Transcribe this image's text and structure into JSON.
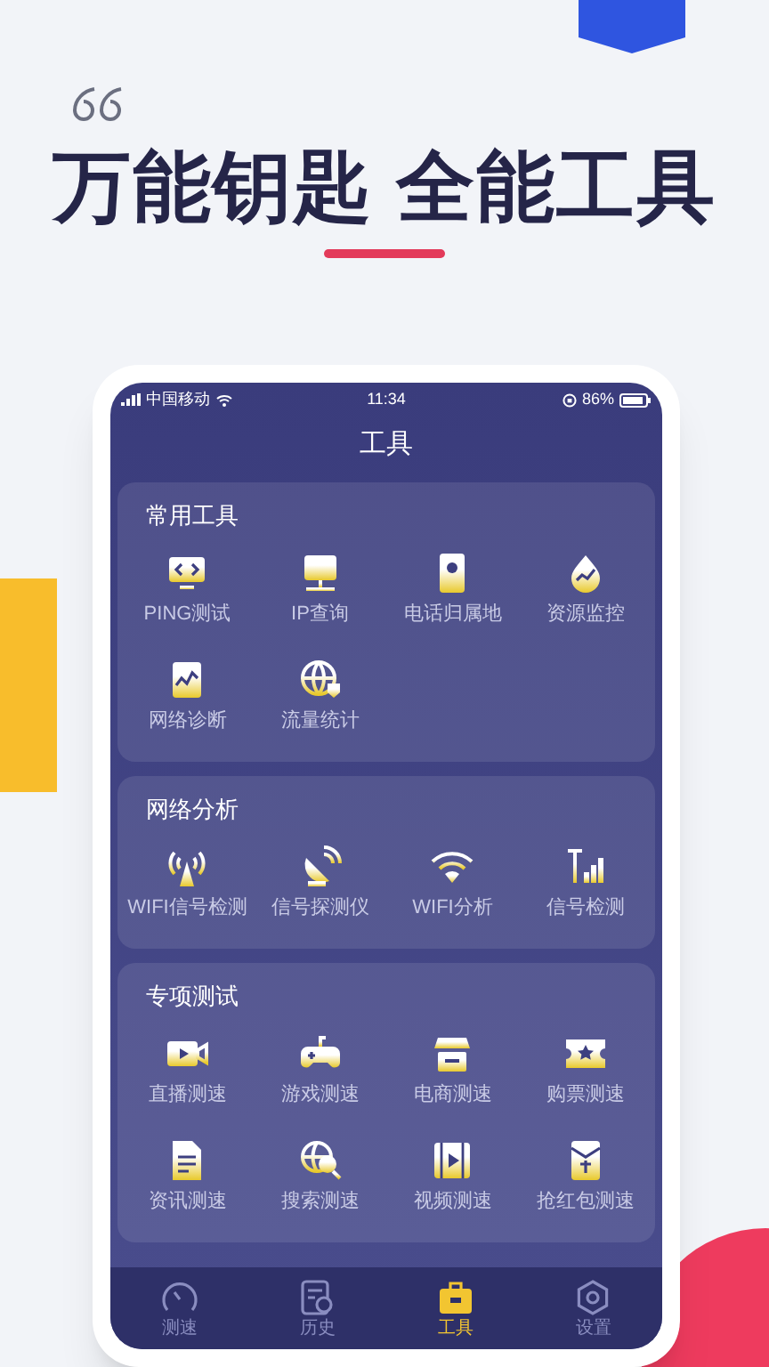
{
  "headline": "万能钥匙 全能工具",
  "status_bar": {
    "carrier": "中国移动",
    "time": "11:34",
    "battery": "86%"
  },
  "title": "工具",
  "sections": [
    {
      "title": "常用工具",
      "items": [
        "PING测试",
        "IP查询",
        "电话归属地",
        "资源监控",
        "网络诊断",
        "流量统计"
      ]
    },
    {
      "title": "网络分析",
      "items": [
        "WIFI信号检测",
        "信号探测仪",
        "WIFI分析",
        "信号检测"
      ]
    },
    {
      "title": "专项测试",
      "items": [
        "直播测速",
        "游戏测速",
        "电商测速",
        "购票测速",
        "资讯测速",
        "搜索测速",
        "视频测速",
        "抢红包测速"
      ]
    }
  ],
  "tabs": [
    {
      "label": "测速",
      "selected": false
    },
    {
      "label": "历史",
      "selected": false
    },
    {
      "label": "工具",
      "selected": true
    },
    {
      "label": "设置",
      "selected": false
    }
  ]
}
